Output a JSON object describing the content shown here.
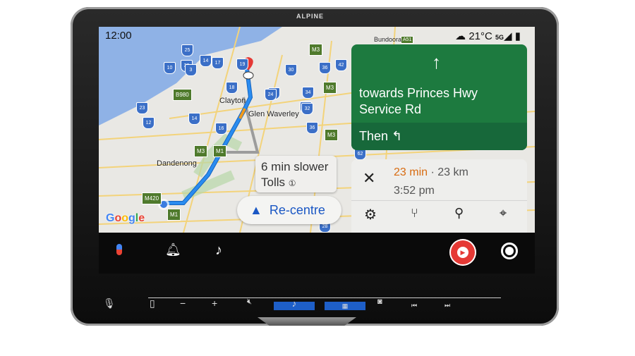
{
  "device": {
    "brand": "ALPINE"
  },
  "status": {
    "time": "12:00",
    "temperature": "21°C",
    "network": "5G",
    "weather_icon": "cloud-icon"
  },
  "map": {
    "places": [
      "Clayton",
      "Glen Waverley",
      "Dandenong",
      "Bundoora"
    ],
    "shields": [
      "25",
      "33",
      "19",
      "30",
      "14",
      "17",
      "26",
      "36",
      "42",
      "10",
      "3",
      "34",
      "18",
      "24",
      "23",
      "23",
      "32",
      "14",
      "12",
      "16",
      "36",
      "62",
      "28"
    ],
    "motorways": [
      "M3",
      "M3",
      "B980",
      "M3",
      "M3",
      "M1",
      "M420",
      "M1",
      "A51"
    ],
    "logo": "Google"
  },
  "navigation": {
    "maneuver_icon": "arrow-up-icon",
    "road": "towards Princes Hwy",
    "road_line2": "Service Rd",
    "then_label": "Then",
    "then_icon": "turn-left-icon"
  },
  "alt_route": {
    "delay": "6 min slower",
    "tolls": "Tolls"
  },
  "recentre": {
    "label": "Re-centre"
  },
  "trip": {
    "duration": "23 min",
    "distance": "· 23 km",
    "arrival": "3:52 pm",
    "duration_color": "#d86c12"
  },
  "controls": {
    "minus": "−",
    "plus": "+"
  },
  "colors": {
    "turn_card": "#1d7a3f",
    "route": "#2a8cf0",
    "accent": "#1a57c4"
  }
}
